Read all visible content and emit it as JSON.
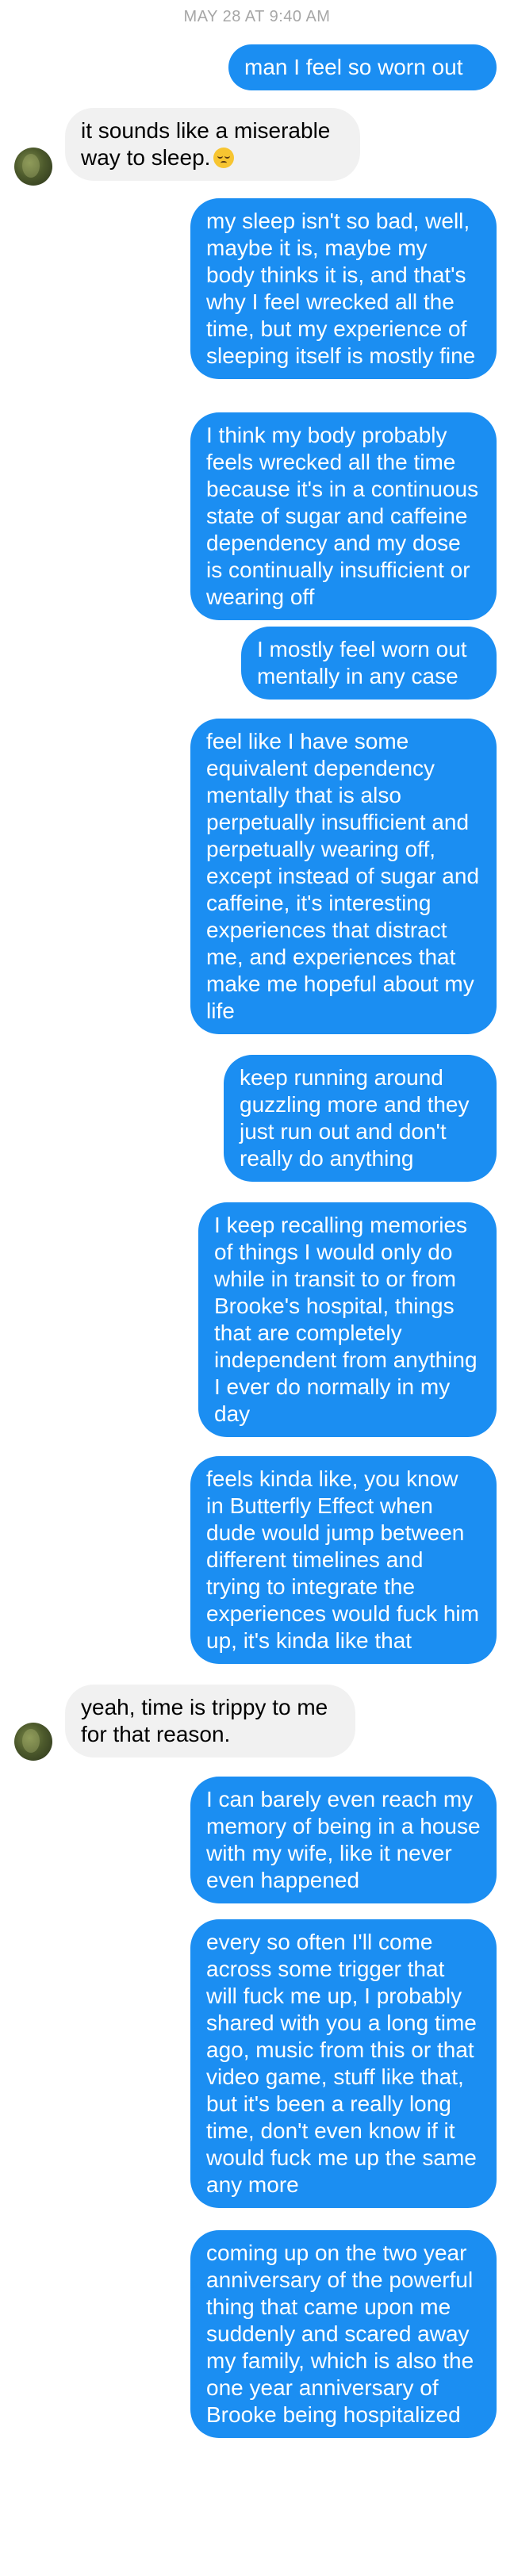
{
  "timestamp": "MAY 28 AT 9:40 AM",
  "contact": {
    "avatar_icon": "user-avatar"
  },
  "colors": {
    "outgoing_bubble": "#1b8ef2",
    "incoming_bubble": "#f1f1f1",
    "timestamp": "#a7a7a7"
  },
  "messages": [
    {
      "sender": "me",
      "text": "man I feel so worn out"
    },
    {
      "sender": "them",
      "text": "it sounds like a miserable way to sleep.",
      "emoji": "pensive-face-emoji"
    },
    {
      "sender": "me",
      "text": "my sleep isn't so bad, well, maybe it is, maybe my body thinks it is, and that's why I feel wrecked all the time, but my experience of sleeping itself is mostly fine"
    },
    {
      "sender": "me",
      "text": "I think my body probably feels wrecked all the time because it's in a continuous state of sugar and caffeine dependency and my dose is continually insufficient or wearing off"
    },
    {
      "sender": "me",
      "text": "I mostly feel worn out mentally in any case"
    },
    {
      "sender": "me",
      "text": "feel like I have some equivalent dependency mentally that is also perpetually insufficient and perpetually wearing off, except instead of sugar and caffeine, it's interesting experiences that distract me, and experiences that make me hopeful about my life"
    },
    {
      "sender": "me",
      "text": "keep running around guzzling more and they just run out and don't really do anything"
    },
    {
      "sender": "me",
      "text": "I keep recalling memories of things I would only do while in transit to or from Brooke's hospital, things that are completely independent from anything I ever do normally in my day"
    },
    {
      "sender": "me",
      "text": "feels kinda like, you know in Butterfly Effect when dude would jump between different timelines and trying to integrate the experiences would fuck him up, it's kinda like that"
    },
    {
      "sender": "them",
      "text": "yeah, time is trippy to me for that reason."
    },
    {
      "sender": "me",
      "text": "I can barely even reach my memory of being in a house with my wife, like it never even happened"
    },
    {
      "sender": "me",
      "text": "every so often I'll come across some trigger that will fuck me up, I probably shared with you a long time ago, music from this or that video game, stuff like that, but it's been a really long time, don't even know if it would fuck me up the same any more"
    },
    {
      "sender": "me",
      "text": "coming up on the two year anniversary of the powerful thing that came upon me suddenly and scared away my family, which is also the one year anniversary of Brooke being hospitalized"
    }
  ]
}
